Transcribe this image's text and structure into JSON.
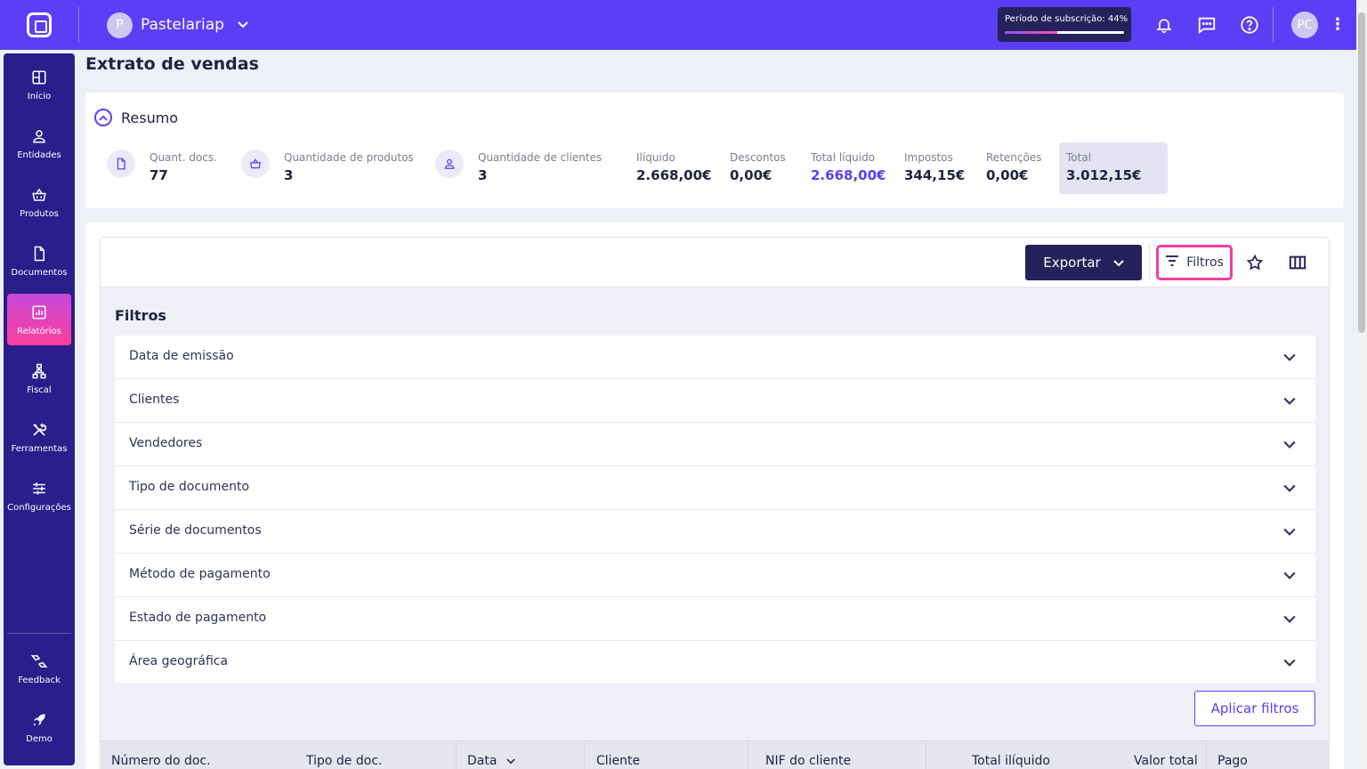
{
  "topbar": {
    "company_initial": "P",
    "company_name": "Pastelariap",
    "subscription_label": "Período de subscrição: 44%",
    "subscription_progress": 0.44,
    "user_initials": "PC"
  },
  "sidebar": {
    "items": [
      {
        "label": "Início",
        "icon": "grid-icon"
      },
      {
        "label": "Entidades",
        "icon": "person-icon"
      },
      {
        "label": "Produtos",
        "icon": "basket-icon"
      },
      {
        "label": "Documentos",
        "icon": "document-icon"
      },
      {
        "label": "Relatórios",
        "icon": "chart-icon",
        "active": true
      },
      {
        "label": "Fiscal",
        "icon": "hierarchy-icon"
      },
      {
        "label": "Ferramentas",
        "icon": "tools-icon"
      },
      {
        "label": "Configurações",
        "icon": "sliders-icon"
      }
    ],
    "bottom": [
      {
        "label": "Feedback",
        "icon": "feedback-icon"
      },
      {
        "label": "Demo",
        "icon": "rocket-icon"
      }
    ]
  },
  "page": {
    "title": "Extrato de vendas"
  },
  "summary": {
    "title": "Resumo",
    "stats": [
      {
        "label": "Quant. docs.",
        "value": "77"
      },
      {
        "label": "Quantidade de produtos",
        "value": "3"
      },
      {
        "label": "Quantidade de clientes",
        "value": "3"
      },
      {
        "label": "Ilíquido",
        "value": "2.668,00€"
      },
      {
        "label": "Descontos",
        "value": "0,00€"
      },
      {
        "label": "Total líquido",
        "value": "2.668,00€"
      },
      {
        "label": "Impostos",
        "value": "344,15€"
      },
      {
        "label": "Retenções",
        "value": "0,00€"
      },
      {
        "label": "Total",
        "value": "3.012,15€"
      }
    ]
  },
  "toolbar": {
    "export_label": "Exportar",
    "filters_label": "Filtros"
  },
  "filters": {
    "title": "Filtros",
    "items": [
      "Data de emissão",
      "Clientes",
      "Vendedores",
      "Tipo de documento",
      "Série de documentos",
      "Método de pagamento",
      "Estado de pagamento",
      "Área geográfica"
    ],
    "apply_label": "Aplicar filtros"
  },
  "table": {
    "columns": [
      "Número do doc.",
      "Tipo de doc.",
      "Data",
      "Cliente",
      "NIF do cliente",
      "Total ilíquido",
      "Valor total",
      "Pago"
    ]
  },
  "colors": {
    "primary": "#5b3ef5",
    "sidebar": "#2b1d8c",
    "dark": "#25215a",
    "highlight": "#f03ea0"
  }
}
